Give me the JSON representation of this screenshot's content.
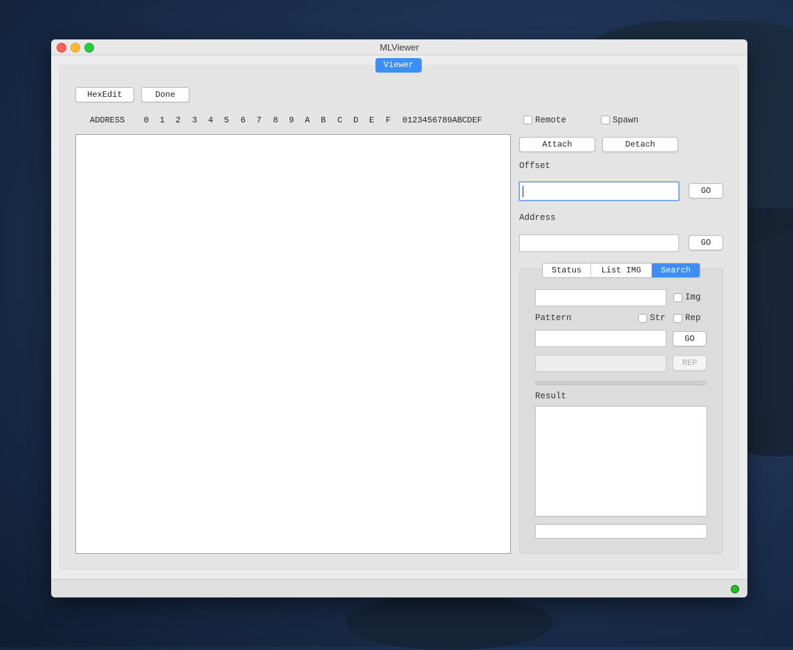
{
  "window": {
    "title": "MLViewer"
  },
  "tabs": {
    "viewer": "Viewer"
  },
  "toolbar": {
    "hexedit_label": "HexEdit",
    "done_label": "Done"
  },
  "hex_header": {
    "address": "ADDRESS",
    "columns": [
      "0",
      "1",
      "2",
      "3",
      "4",
      "5",
      "6",
      "7",
      "8",
      "9",
      "A",
      "B",
      "C",
      "D",
      "E",
      "F"
    ],
    "ascii": "0123456789ABCDEF"
  },
  "connection": {
    "remote_label": "Remote",
    "spawn_label": "Spawn",
    "attach_label": "Attach",
    "detach_label": "Detach",
    "remote_checked": false,
    "spawn_checked": false
  },
  "offset": {
    "label": "Offset",
    "value": "",
    "go_label": "GO"
  },
  "address": {
    "label": "Address",
    "value": "",
    "go_label": "GO"
  },
  "side_tabs": {
    "items": [
      "Status",
      "List IMG",
      "Search"
    ],
    "active": "Search"
  },
  "search": {
    "query_value": "",
    "img_label": "Img",
    "pattern_label": "Pattern",
    "str_label": "Str",
    "rep_label": "Rep",
    "pattern_value": "",
    "go_label": "GO",
    "replace_value": "",
    "rep_button_label": "REP",
    "progress": 0,
    "result_label": "Result",
    "result_text": "",
    "footer_value": ""
  },
  "status": {
    "indicator_color": "#1ec21e"
  }
}
